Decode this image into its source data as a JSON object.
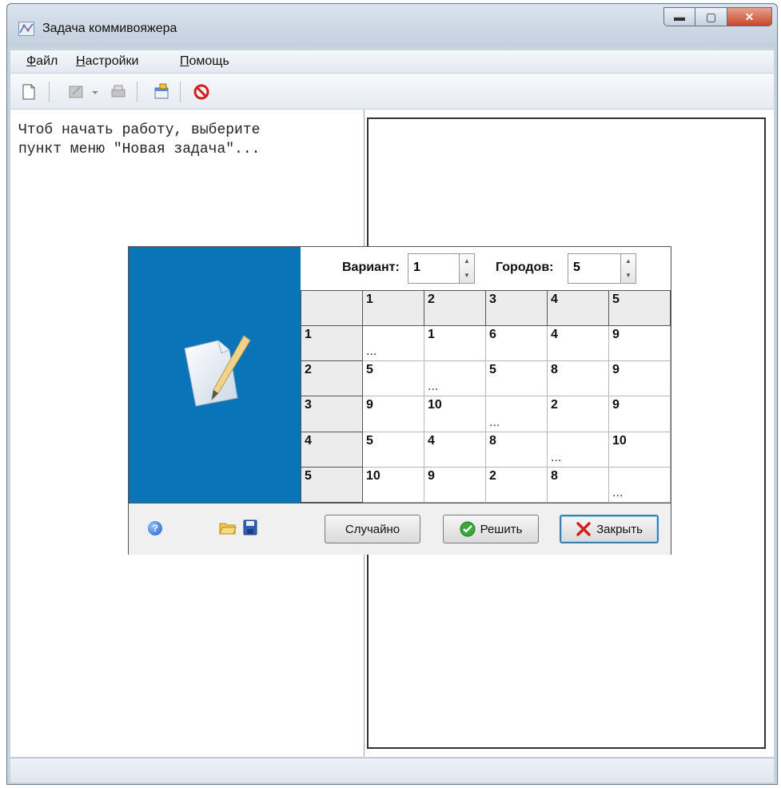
{
  "window": {
    "title": "Задача коммивояжера"
  },
  "titlebar_buttons": {
    "minimize": "▬",
    "maximize": "▢",
    "close": "✕"
  },
  "menu": [
    {
      "underline": "Ф",
      "rest": "айл"
    },
    {
      "underline": "Н",
      "rest": "астройки"
    },
    {
      "underline": "П",
      "rest": "омощь"
    }
  ],
  "hint_text": "Чтоб начать работу, выберите\nпункт меню \"Новая задача\"...",
  "dialog": {
    "variant_label": "Вариант:",
    "variant_value": "1",
    "cities_label": "Городов:",
    "cities_value": "5",
    "columns": [
      "1",
      "2",
      "3",
      "4",
      "5"
    ],
    "rows": [
      {
        "label": "1",
        "cells": [
          "...",
          "1",
          "6",
          "4",
          "9"
        ]
      },
      {
        "label": "2",
        "cells": [
          "5",
          "...",
          "5",
          "8",
          "9"
        ]
      },
      {
        "label": "3",
        "cells": [
          "9",
          "10",
          "...",
          "2",
          "9"
        ]
      },
      {
        "label": "4",
        "cells": [
          "5",
          "4",
          "8",
          "...",
          "10"
        ]
      },
      {
        "label": "5",
        "cells": [
          "10",
          "9",
          "2",
          "8",
          "..."
        ]
      }
    ],
    "buttons": {
      "random": "Случайно",
      "solve": "Решить",
      "close": "Закрыть"
    },
    "help_glyph": "?"
  },
  "colors": {
    "accent_blue": "#0a74b9"
  }
}
